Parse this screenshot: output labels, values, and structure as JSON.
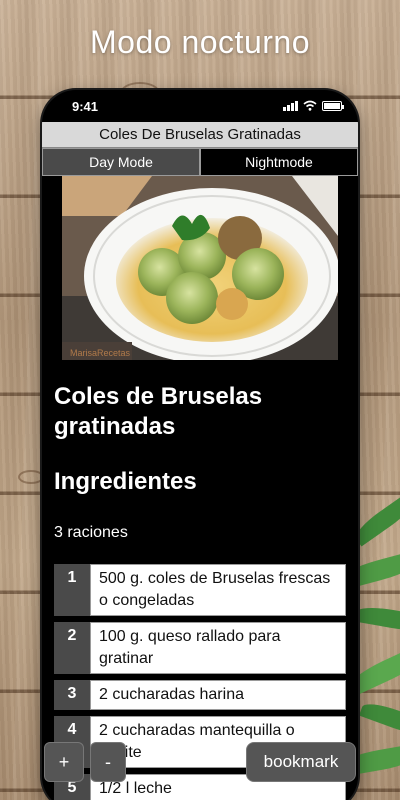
{
  "promo": {
    "title": "Modo nocturno"
  },
  "status": {
    "time": "9:41"
  },
  "app": {
    "title": "Coles De Bruselas Gratinadas",
    "modes": {
      "day": "Day Mode",
      "night": "Nightmode",
      "active": "Nightmode"
    }
  },
  "recipe": {
    "title": "Coles de Bruselas gratinadas",
    "section": "Ingredientes",
    "servings": "3 raciones",
    "photo_watermark": "MarisaRecetas",
    "ingredients": [
      {
        "num": "1",
        "text": "500 g. coles de Bruselas frescas o congeladas"
      },
      {
        "num": "2",
        "text": "100 g. queso rallado para gratinar"
      },
      {
        "num": "3",
        "text": "2 cucharadas harina"
      },
      {
        "num": "4",
        "text": "2 cucharadas mantequilla o aceite"
      },
      {
        "num": "5",
        "text": "1/2 l leche"
      }
    ]
  },
  "controls": {
    "plus": "+",
    "minus": "-",
    "bookmark": "bookmark"
  },
  "colors": {
    "accent_gray": "#4a4a4a",
    "appbar": "#d9d9d9",
    "background": "#000000"
  }
}
